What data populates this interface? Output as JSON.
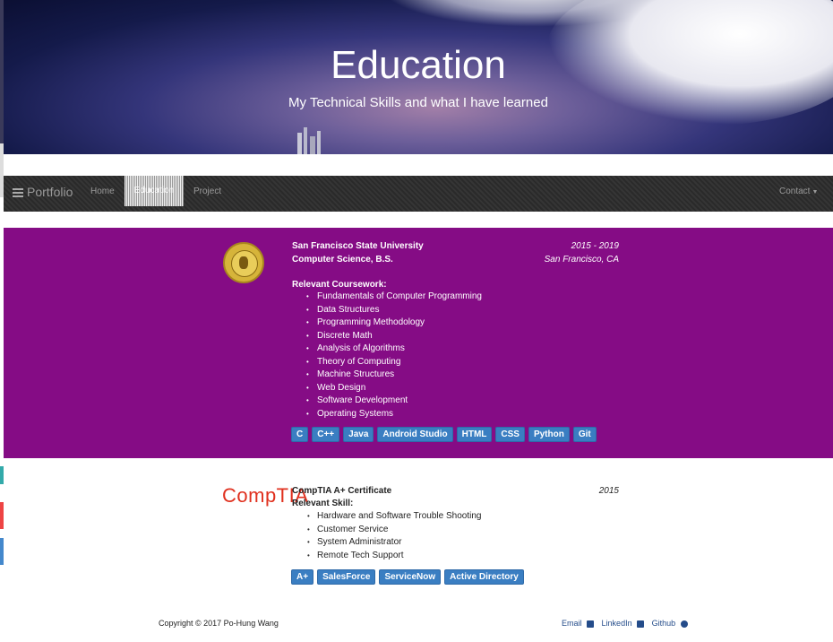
{
  "hero": {
    "title": "Education",
    "subtitle": "My Technical Skills and what I have learned"
  },
  "navbar": {
    "brand": "Portfolio",
    "brand_icon": "bars-icon",
    "links": [
      {
        "label": "Home"
      },
      {
        "label": "Education",
        "active": true
      },
      {
        "label": "Project"
      }
    ],
    "contact": "Contact",
    "contact_icon": "caret-down-icon"
  },
  "education": {
    "school": "San Francisco State University",
    "years": "2015 - 2019",
    "degree": "Computer Science, B.S.",
    "location": "San Francisco, CA",
    "coursework_label": "Relevant Coursework:",
    "coursework": [
      "Fundamentals of Computer Programming",
      "Data Structures",
      "Programming Methodology",
      "Discrete Math",
      "Analysis of Algorithms",
      "Theory of Computing",
      "Machine Structures",
      "Web Design",
      "Software Development",
      "Operating Systems"
    ],
    "skills": [
      "C",
      "C++",
      "Java",
      "Android Studio",
      "HTML",
      "CSS",
      "Python",
      "Git"
    ]
  },
  "certificate": {
    "logo_text": "CompTIA",
    "name": "CompTIA A+ Certificate",
    "year": "2015",
    "skill_label": "Relevant Skill:",
    "skills": [
      "Hardware and Software Trouble Shooting",
      "Customer Service",
      "System Administrator",
      "Remote Tech Support"
    ],
    "tags": [
      "A+",
      "SalesForce",
      "ServiceNow",
      "Active Directory"
    ]
  },
  "footer": {
    "copyright": "Copyright © 2017 Po-Hung Wang",
    "links": [
      {
        "label": "Email",
        "icon": "envelope-icon"
      },
      {
        "label": "LinkedIn",
        "icon": "linkedin-icon"
      },
      {
        "label": "Github",
        "icon": "github-icon"
      }
    ]
  },
  "colors": {
    "section_bg": "#850c85",
    "tag_bg": "#3a7ec2",
    "navbar_bg": "#2a2a2a",
    "comptia_red": "#e0301e"
  }
}
